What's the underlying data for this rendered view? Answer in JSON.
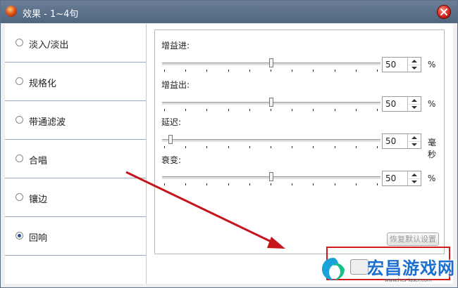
{
  "window": {
    "title": "效果 - 1~4句"
  },
  "sidebar": {
    "items": [
      {
        "label": "淡入/淡出",
        "checked": false
      },
      {
        "label": "规格化",
        "checked": false
      },
      {
        "label": "带通滤波",
        "checked": false
      },
      {
        "label": "合唱",
        "checked": false
      },
      {
        "label": "镶边",
        "checked": false
      },
      {
        "label": "回响",
        "checked": true
      }
    ]
  },
  "params": [
    {
      "label": "增益进:",
      "value": "50",
      "unit": "%",
      "level": 0.5
    },
    {
      "label": "增益出:",
      "value": "50",
      "unit": "%",
      "level": 0.5
    },
    {
      "label": "延迟:",
      "value": "50",
      "unit": "毫秒",
      "level": 0.03
    },
    {
      "label": "衰变:",
      "value": "50",
      "unit": "%",
      "level": 0.5
    }
  ],
  "buttons": {
    "restore_defaults": "恢复默认设置"
  },
  "watermark": {
    "text": "宏昌游戏网",
    "url": "www.hcs-laser.com"
  },
  "icons": {
    "app": "app-flame-icon",
    "close": "close-icon",
    "spin_up": "spin-up-arrow-icon",
    "spin_down": "spin-down-arrow-icon"
  },
  "colors": {
    "titlebar": "#5a6f86",
    "annotation_red": "#d11a1a",
    "watermark_blue": "#1a6fd0"
  }
}
